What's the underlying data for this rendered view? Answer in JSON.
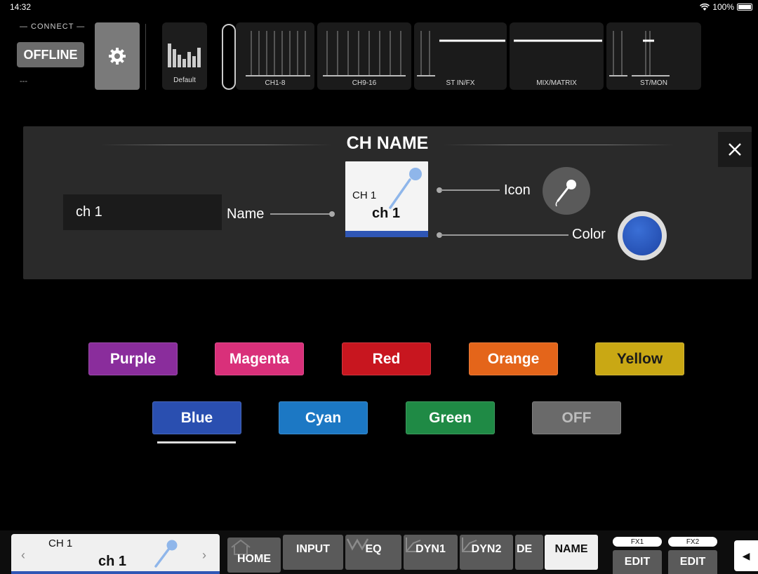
{
  "status": {
    "time": "14:32",
    "battery": "100%"
  },
  "connect": {
    "label": "— CONNECT —",
    "button": "OFFLINE",
    "sub": "---"
  },
  "scene": {
    "label": "Default"
  },
  "banks": [
    {
      "label": "CH1-8"
    },
    {
      "label": "CH9-16"
    },
    {
      "label": "ST IN/FX"
    },
    {
      "label": "MIX/MATRIX"
    },
    {
      "label": "ST/MON"
    }
  ],
  "panel": {
    "title": "CH NAME",
    "name_value": "ch 1",
    "name_label": "Name",
    "icon_label": "Icon",
    "color_label": "Color",
    "preview": {
      "ch": "CH 1",
      "name": "ch 1",
      "color": "#2f56b5"
    }
  },
  "colors": {
    "selected": "Blue",
    "buttons": [
      {
        "label": "Purple",
        "bg": "#8a2d9c",
        "fg": "#ffffff"
      },
      {
        "label": "Magenta",
        "bg": "#d9307a",
        "fg": "#ffffff"
      },
      {
        "label": "Red",
        "bg": "#c8161f",
        "fg": "#ffffff"
      },
      {
        "label": "Orange",
        "bg": "#e4651a",
        "fg": "#ffffff"
      },
      {
        "label": "Yellow",
        "bg": "#c9a814",
        "fg": "#1a1a1a"
      },
      {
        "label": "Blue",
        "bg": "#2a4fb0",
        "fg": "#ffffff"
      },
      {
        "label": "Cyan",
        "bg": "#1c78c4",
        "fg": "#ffffff"
      },
      {
        "label": "Green",
        "bg": "#1f8a45",
        "fg": "#ffffff"
      },
      {
        "label": "OFF",
        "bg": "#6a6a6a",
        "fg": "#bdbdbd"
      }
    ]
  },
  "bottom": {
    "ch": "CH 1",
    "name": "ch 1",
    "tabs": [
      {
        "label": "HOME",
        "icon": "home-icon"
      },
      {
        "label": "INPUT",
        "icon": "input-icon"
      },
      {
        "label": "EQ",
        "icon": "eq-icon"
      },
      {
        "label": "DYN1",
        "icon": "dyn-icon"
      },
      {
        "label": "DYN2",
        "icon": "dyn-icon"
      },
      {
        "label": "DE",
        "icon": "delay-icon"
      },
      {
        "label": "NAME",
        "icon": "name-icon"
      }
    ],
    "fx1_label": "FX1",
    "fx2_label": "FX2",
    "edit_label": "EDIT"
  }
}
